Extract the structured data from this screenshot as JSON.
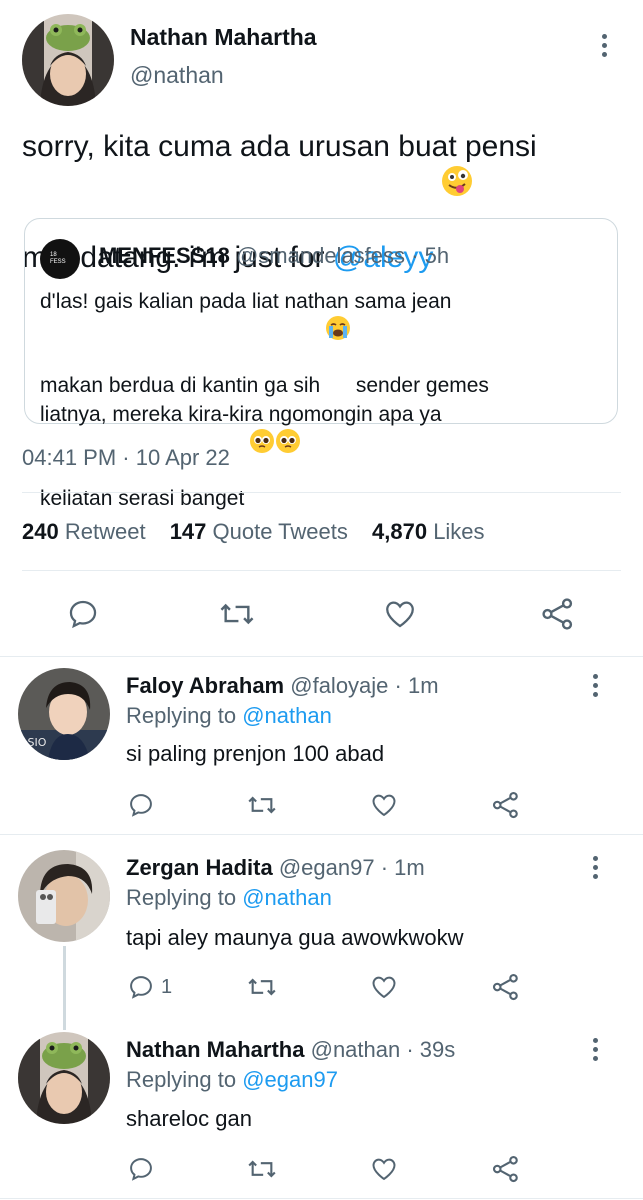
{
  "main_tweet": {
    "author_name": "Nathan Mahartha",
    "author_handle": "@nathan",
    "text_part1": "sorry, kita cuma ada urusan buat pensi",
    "text_part2": "mendatang. i'm just for ",
    "mention": "@aleyy",
    "emoji": "zany-face-emoji",
    "quoted": {
      "logo_text": "18 FESS",
      "name": "MENFESS18",
      "handle": "@smandelasfess",
      "time": "· 5h",
      "line1": "d'las! gais kalian pada liat nathan sama jean",
      "line2a": "makan berdua di kantin ga sih ",
      "line2b": " sender gemes",
      "line3": "liatnya, mereka kira-kira ngomongin apa ya",
      "line4": "keliatan serasi banget "
    },
    "timestamp": "04:41 PM · 10 Apr 22",
    "stats": {
      "retweets": "240",
      "retweets_label": "Retweet",
      "quotes": "147",
      "quotes_label": "Quote Tweets",
      "likes": "4,870",
      "likes_label": "Likes"
    }
  },
  "replies": [
    {
      "name": "Faloy Abraham",
      "handle": "@faloyaje",
      "time": "· 1m",
      "replying_label": "Replying to ",
      "replying_to": "@nathan",
      "text": "si paling prenjon 100 abad",
      "reply_count": ""
    },
    {
      "name": "Zergan Hadita",
      "handle": "@egan97",
      "time": "· 1m",
      "replying_label": "Replying to ",
      "replying_to": "@nathan",
      "text": "tapi aley maunya gua awowkwokw",
      "reply_count": "1"
    },
    {
      "name": "Nathan Mahartha",
      "handle": "@nathan",
      "time": "· 39s",
      "replying_label": "Replying to ",
      "replying_to": "@egan97",
      "text": "shareloc gan",
      "reply_count": ""
    }
  ],
  "colors": {
    "accent": "#1d9bf0",
    "secondary_text": "#536471",
    "divider": "#e6ecf0"
  }
}
